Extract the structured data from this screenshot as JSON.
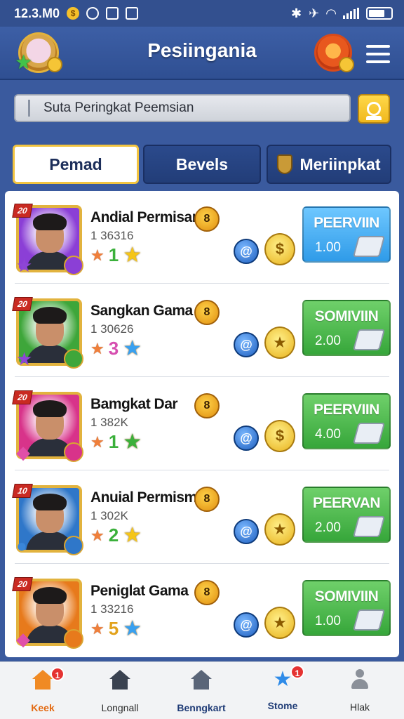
{
  "status_bar": {
    "time": "12.3.M0"
  },
  "header": {
    "title": "Pesiingania"
  },
  "search": {
    "placeholder": "Suta Peringkat Peemsian"
  },
  "tabs": [
    {
      "label": "Pemad",
      "active": true
    },
    {
      "label": "Bevels",
      "active": false
    },
    {
      "label": "Meriinpkat",
      "active": false,
      "icon": "shield-icon"
    }
  ],
  "rows": [
    {
      "level": "20",
      "name": "Andial Permisan",
      "score": "1 36316",
      "count_badge": "8",
      "stat_value": "1",
      "stat_color": "#3bb03b",
      "star_color": "#f5c518",
      "bg": "#8b3fd6",
      "corner_gem": "purple-star-icon",
      "button_label": "PEERVIIN",
      "button_value": "1.00",
      "button_color": "blue",
      "reward_icon": "dollar-coin-icon"
    },
    {
      "level": "20",
      "name": "Sangkan Gama",
      "score": "1 30626",
      "count_badge": "8",
      "stat_value": "3",
      "stat_color": "#d64fb0",
      "star_color": "#39a0f0",
      "bg": "#3ea63a",
      "corner_gem": "purple-star-icon",
      "button_label": "SOMIVIIN",
      "button_value": "2.00",
      "button_color": "green",
      "reward_icon": "star-medal-icon"
    },
    {
      "level": "20",
      "name": "Bamgkat Dar",
      "score": "1 382K",
      "count_badge": "8",
      "stat_value": "1",
      "stat_color": "#3bb03b",
      "star_color": "#3bb03b",
      "bg": "#d8338a",
      "corner_gem": "pink-gem-icon",
      "button_label": "PEERVIIN",
      "button_value": "4.00",
      "button_color": "green",
      "reward_icon": "dollar-coin-icon"
    },
    {
      "level": "10",
      "name": "Anuial Permism",
      "score": "1 302K",
      "count_badge": "8",
      "stat_value": "2",
      "stat_color": "#3bb03b",
      "star_color": "#f5c518",
      "bg": "#2f77c9",
      "corner_gem": "blue-coin-icon",
      "button_label": "PEERVAN",
      "button_value": "2.00",
      "button_color": "green",
      "reward_icon": "star-medal-icon"
    },
    {
      "level": "20",
      "name": "Peniglat Gama",
      "score": "1 33216",
      "count_badge": "8",
      "stat_value": "5",
      "stat_color": "#e2a21c",
      "star_color": "#39a0f0",
      "bg": "#e77a1c",
      "corner_gem": "pink-gem-icon",
      "button_label": "SOMIVIIN",
      "button_value": "1.00",
      "button_color": "green",
      "reward_icon": "star-medal-icon"
    }
  ],
  "bottom_nav": [
    {
      "label": "Keek",
      "active": true,
      "badge": "1",
      "icon": "home-icon"
    },
    {
      "label": "Longnall",
      "active": false,
      "badge": "",
      "icon": "home-dark-icon"
    },
    {
      "label": "Benngkart",
      "active": false,
      "badge": "",
      "icon": "store-icon"
    },
    {
      "label": "Stome",
      "active": false,
      "badge": "1",
      "icon": "star-icon"
    },
    {
      "label": "Hlak",
      "active": false,
      "badge": "",
      "icon": "profile-icon"
    }
  ]
}
